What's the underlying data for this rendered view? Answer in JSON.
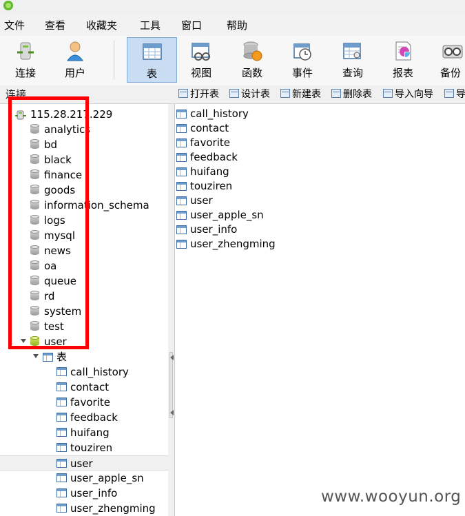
{
  "menubar": {
    "items": [
      "文件",
      "查看",
      "收藏夹",
      "工具",
      "窗口",
      "帮助"
    ]
  },
  "toolbar": {
    "buttons": [
      {
        "label": "连接",
        "icon": "connect-icon"
      },
      {
        "label": "用户",
        "icon": "user-icon"
      },
      {
        "label": "表",
        "icon": "table-icon",
        "active": true
      },
      {
        "label": "视图",
        "icon": "view-icon"
      },
      {
        "label": "函数",
        "icon": "function-icon"
      },
      {
        "label": "事件",
        "icon": "event-icon"
      },
      {
        "label": "查询",
        "icon": "query-icon"
      },
      {
        "label": "报表",
        "icon": "report-icon"
      },
      {
        "label": "备份",
        "icon": "backup-icon"
      }
    ]
  },
  "subbar": {
    "connection_label": "连接",
    "actions": [
      "打开表",
      "设计表",
      "新建表",
      "删除表",
      "导入向导",
      "导"
    ]
  },
  "tree": {
    "server": "115.28.217.229",
    "databases": [
      "analytics",
      "bd",
      "black",
      "finance",
      "goods",
      "information_schema",
      "logs",
      "mysql",
      "news",
      "oa",
      "queue",
      "rd",
      "system",
      "test",
      "user"
    ],
    "expanded_database": "user",
    "tables_group_label": "表",
    "tables": [
      "call_history",
      "contact",
      "favorite",
      "feedback",
      "huifang",
      "touziren",
      "user",
      "user_apple_sn",
      "user_info",
      "user_zhengming"
    ],
    "selected_table": "user"
  },
  "objects": {
    "items": [
      "call_history",
      "contact",
      "favorite",
      "feedback",
      "huifang",
      "touziren",
      "user",
      "user_apple_sn",
      "user_info",
      "user_zhengming"
    ]
  },
  "watermark": "www.wooyun.org",
  "colors": {
    "annotation": "#ff0000",
    "active_tool_bg": "#c8ddf2"
  }
}
